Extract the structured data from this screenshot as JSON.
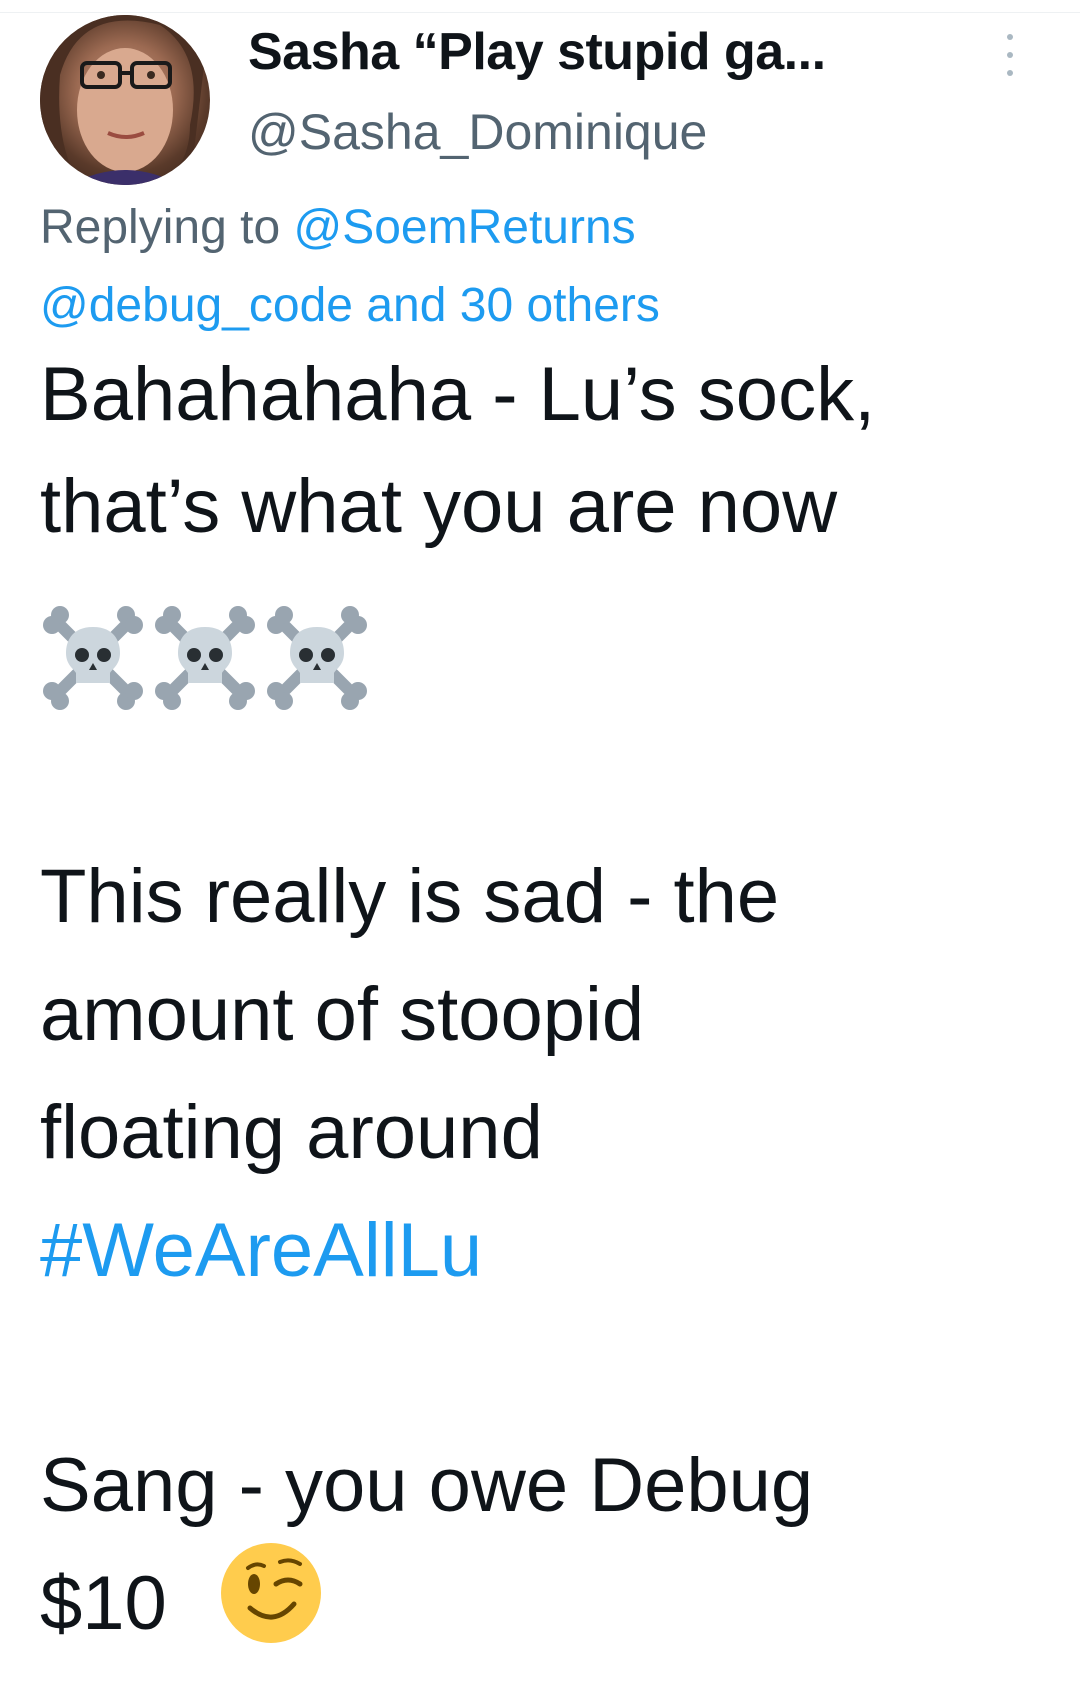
{
  "tweet": {
    "display_name": "Sasha “Play stupid ga...",
    "handle": "@Sasha_Dominique",
    "more_icon": "more-vertical-icon",
    "reply": {
      "prefix": "Replying to ",
      "mention_1": "@SoemReturns",
      "mention_2": "@debug_code",
      "and_text": " and ",
      "others": "30 others"
    },
    "lines": {
      "line1": "Bahahahaha - Lu’s sock,",
      "line2": "that’s what you are now",
      "line3": "This really is sad - the",
      "line4": "amount of stoopid",
      "line5": "floating around",
      "hashtag": "#WeAreAllLu",
      "line6": "Sang - you owe Debug",
      "line7": "$10"
    },
    "emojis": [
      "skull-crossbones-icon",
      "skull-crossbones-icon",
      "skull-crossbones-icon",
      "winking-face-icon"
    ],
    "colors": {
      "link": "#1d9bf0",
      "secondary": "#536471",
      "text": "#0f1419"
    }
  }
}
